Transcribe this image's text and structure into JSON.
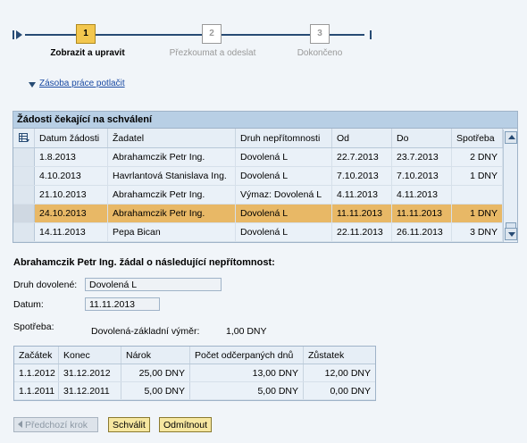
{
  "roadmap": {
    "steps": [
      {
        "num": "1",
        "label": "Zobrazit a upravit"
      },
      {
        "num": "2",
        "label": "Přezkoumat a odeslat"
      },
      {
        "num": "3",
        "label": "Dokončeno"
      }
    ]
  },
  "collapse_link": "Zásoba práce potlačit",
  "table": {
    "title": "Žádosti čekající na schválení",
    "headers": [
      "Datum žádosti",
      "Žadatel",
      "Druh nepřítomnosti",
      "Od",
      "Do",
      "Spotřeba"
    ],
    "rows": [
      [
        "1.8.2013",
        "Abrahamczik Petr Ing.",
        "Dovolená L",
        "22.7.2013",
        "23.7.2013",
        "2 DNY"
      ],
      [
        "4.10.2013",
        "Havrlantová Stanislava Ing.",
        "Dovolená L",
        "7.10.2013",
        "7.10.2013",
        "1 DNY"
      ],
      [
        "21.10.2013",
        "Abrahamczik Petr Ing.",
        "Výmaz: Dovolená L",
        "4.11.2013",
        "4.11.2013",
        ""
      ],
      [
        "24.10.2013",
        "Abrahamczik Petr Ing.",
        "Dovolená L",
        "11.11.2013",
        "11.11.2013",
        "1 DNY"
      ],
      [
        "14.11.2013",
        "Pepa Bican",
        "Dovolená L",
        "22.11.2013",
        "26.11.2013",
        "3 DNY"
      ]
    ],
    "selected_row": 3
  },
  "detail": {
    "heading": "Abrahamczik Petr Ing. žádal o následující nepřítomnost:",
    "druh_label": "Druh dovolené:",
    "druh_value": "Dovolená L",
    "datum_label": "Datum:",
    "datum_value": "11.11.2013",
    "spotreba_label": "Spotřeba:",
    "vymer_label": "Dovolená-základní výměr:",
    "vymer_value": "1,00 DNY"
  },
  "quota_table": {
    "headers": [
      "Začátek",
      "Konec",
      "Nárok",
      "Počet odčerpaných dnů",
      "Zůstatek"
    ],
    "rows": [
      [
        "1.1.2012",
        "31.12.2012",
        "25,00 DNY",
        "13,00 DNY",
        "12,00 DNY"
      ],
      [
        "1.1.2011",
        "31.12.2011",
        "5,00 DNY",
        "5,00 DNY",
        "0,00 DNY"
      ]
    ]
  },
  "buttons": {
    "prev": "Předchozí krok",
    "approve": "Schválit",
    "reject": "Odmítnout"
  }
}
